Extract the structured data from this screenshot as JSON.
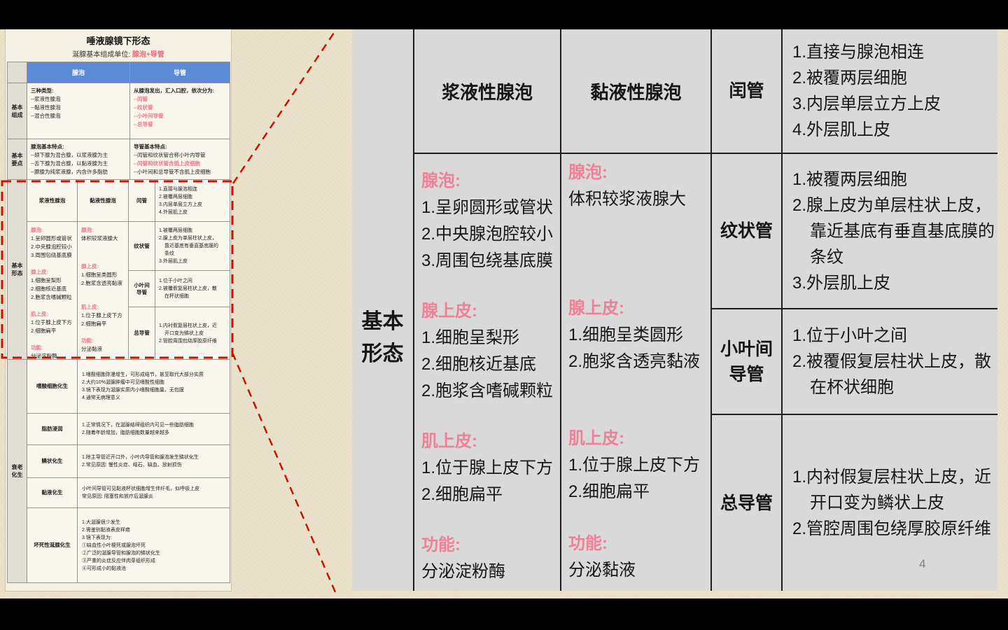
{
  "colors": {
    "accent_pink": "#EE8198",
    "header_blue": "#5A8AD8",
    "highlight_red": "#CC1100",
    "panel_gray": "#D9D9D9",
    "background_beige": "#EAE1C9"
  },
  "page": {
    "number": "4"
  },
  "thumbnail": {
    "title": "唾液腺镜下形态",
    "subtitle_label": "涎腺基本组成单位: ",
    "subtitle_value": "腺泡+导管",
    "col_acinus": "腺泡",
    "col_duct": "导管",
    "composition": {
      "label": "基本组成",
      "acinus": [
        {
          "t": "三种类型:",
          "c": "b"
        },
        {
          "t": "--浆液性腺泡"
        },
        {
          "t": "--黏液性腺泡"
        },
        {
          "t": "--混合性腺泡"
        }
      ],
      "duct": [
        {
          "t": "从腺泡发出，汇入口腔，依次分为:",
          "c": "b"
        },
        {
          "t": "--闰管",
          "c": "pink"
        },
        {
          "t": "--纹状管",
          "c": "pink"
        },
        {
          "t": "--小叶间导管",
          "c": "pink"
        },
        {
          "t": "--总导管",
          "c": "pink"
        }
      ]
    },
    "keypoints": {
      "label": "基本要点",
      "acinus": [
        {
          "t": "腺泡基本特点:",
          "c": "b"
        },
        {
          "t": "--颌下腺为混合腺，以浆液腺为主"
        },
        {
          "t": "--舌下腺为混合腺，以黏液腺为主"
        },
        {
          "t": "--腮腺为纯浆液腺，内含许多脂肪"
        }
      ],
      "duct": [
        {
          "t": "导管基本特点:",
          "c": "b"
        },
        {
          "t": "--闰管和纹状管合称小叶内导管"
        },
        {
          "t": "--闰管和纹状管含肌上皮细胞",
          "c": "pink"
        },
        {
          "t": "--小叶间和总导管不含肌上皮细胞"
        }
      ]
    },
    "metaplasia": {
      "label": "衰老化生",
      "rows": [
        {
          "label": "嗜酸细胞化生",
          "lines": [
            "1.嗜酸细胞弥漫增生，可形成结节，甚至取代大部分实质",
            "2.大约10%涎腺肿瘤中可见嗜酸性细胞",
            "3.镜下表现为涎腺实质内小嗜酸细胞巢，无包膜",
            "4.通常无病理意义"
          ]
        },
        {
          "label": "脂肪浸润",
          "lines": [
            "1.正常情况下，在涎腺结缔组织内可见一些脂肪细胞",
            "2.随着年龄增加，脂肪细胞数量越来越多"
          ]
        },
        {
          "label": "鳞状化生",
          "lines": [
            "1.除主导管近开口外，小叶内导管和腺泡发生鳞状化生",
            "2.常见原因: 慢性炎症、结石、缺血、放射损伤"
          ]
        },
        {
          "label": "黏液化生",
          "lines": [
            "小叶间导管可见黏液杯状细胞增生伴纤毛，似呼吸上皮",
            "常见原因: 阻塞性和放疗后涎腺炎"
          ]
        },
        {
          "label": "坏死性涎腺化生",
          "lines": [
            "1.大涎腺很少发生",
            "2.需鉴别黏液表皮样癌",
            "3.镜下表现为:",
            "①缺血性小叶梗死或腺泡坏死",
            "②广泛的涎腺导管和腺泡的鳞状化生",
            "③严重的炎症反应伴肉芽组织形成",
            "④可形成小的黏液池"
          ]
        }
      ]
    }
  },
  "morphology": {
    "row_label": "基本形态",
    "serous": {
      "header": "浆液性腺泡",
      "groups": [
        {
          "heading": "腺泡:",
          "lines": [
            "1.呈卵圆形或管状",
            "2.中央腺泡腔较小",
            "3.周围包绕基底膜"
          ]
        },
        {
          "heading": "腺上皮:",
          "lines": [
            "1.细胞呈梨形",
            "2.细胞核近基底",
            "2.胞浆含嗜碱颗粒"
          ]
        },
        {
          "heading": "肌上皮:",
          "lines": [
            "1.位于腺上皮下方",
            "2.细胞扁平"
          ]
        },
        {
          "heading": "功能:",
          "lines": [
            "分泌淀粉酶"
          ]
        }
      ]
    },
    "mucous": {
      "header": "黏液性腺泡",
      "groups": [
        {
          "heading": "腺泡:",
          "lines": [
            "体积较浆液腺大"
          ]
        },
        {
          "heading": "腺上皮:",
          "lines": [
            "1.细胞呈类圆形",
            "2.胞浆含透亮黏液"
          ]
        },
        {
          "heading": "肌上皮:",
          "lines": [
            "1.位于腺上皮下方",
            "2.细胞扁平"
          ]
        },
        {
          "heading": "功能:",
          "lines": [
            "分泌黏液"
          ]
        }
      ]
    },
    "ducts": [
      {
        "label": "闰管",
        "lines": [
          {
            "t": "1.直接与腺泡相连"
          },
          {
            "t": "2.被覆两层细胞"
          },
          {
            "t": "3.内层单层立方上皮"
          },
          {
            "t": "4.外层肌上皮"
          }
        ]
      },
      {
        "label": "纹状管",
        "lines": [
          {
            "t": "1.被覆两层细胞"
          },
          {
            "t": "2.腺上皮为单层柱状上皮，"
          },
          {
            "t": "靠近基底有垂直基底膜的",
            "c": "ind"
          },
          {
            "t": "条纹",
            "c": "ind"
          },
          {
            "t": "3.外层肌上皮"
          }
        ]
      },
      {
        "label": "小叶间导管",
        "lines": [
          {
            "t": "1.位于小叶之间"
          },
          {
            "t": "2.被覆假复层柱状上皮，散"
          },
          {
            "t": "在杯状细胞",
            "c": "ind"
          }
        ]
      },
      {
        "label": "总导管",
        "lines": [
          {
            "t": "1.内衬假复层柱状上皮，近"
          },
          {
            "t": "开口变为鳞状上皮",
            "c": "ind"
          },
          {
            "t": "2.管腔周围包绕厚胶原纤维"
          }
        ]
      }
    ]
  }
}
